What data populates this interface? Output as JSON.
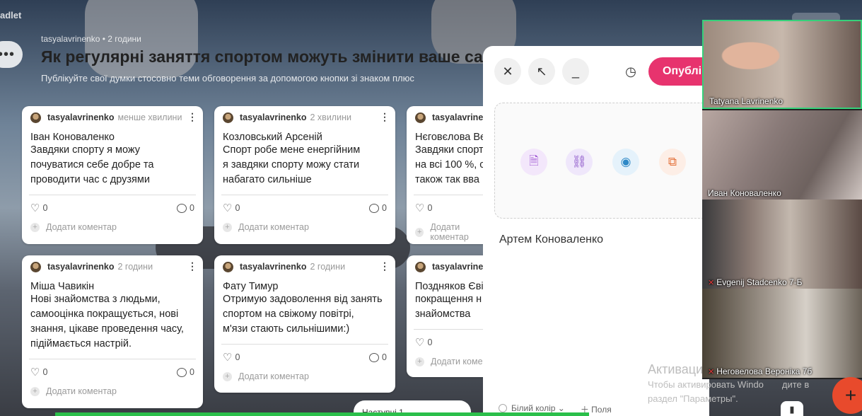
{
  "app": {
    "brand": "adlet"
  },
  "header": {
    "author": "tasyalavrinenko",
    "time": "2 години",
    "title": "Як регулярні заняття спортом можуть змінити ваше са",
    "subtitle": "Публікуйте свої думки стосовно теми обговорення за допомогою кнопки зі знаком плюс"
  },
  "cards": [
    {
      "author": "tasyalavrinenko",
      "time": "менше хвилини",
      "title": "Іван Коноваленко",
      "lines": [
        "Завдяки спорту я можу",
        "почуватися себе добре та",
        "проводити час с друзями"
      ],
      "likes": "0",
      "comments": "0",
      "add_comment": "Додати коментар"
    },
    {
      "author": "tasyalavrinenko",
      "time": "2 хвилини",
      "title": "Козловський Арсеній",
      "lines": [
        "Спорт робе мене енергійним",
        "я завдяки спорту можу стати",
        "набагато сильніше"
      ],
      "likes": "0",
      "comments": "0",
      "add_comment": "Додати коментар"
    },
    {
      "author": "tasyalavrinenko",
      "time": "",
      "title": "Нєговєлова Ве",
      "lines": [
        "Завдяки спорт",
        "на всі 100 %, с",
        "також так вва"
      ],
      "likes": "0",
      "comments": "",
      "add_comment": "Додати коментар"
    },
    {
      "author": "tasyalavrinenko",
      "time": "2 години",
      "title": "Міша Чавикін",
      "lines": [
        "Нові знайомства з людьми,",
        "самооцінка покращується, нові",
        "знання, цікаве проведення часу,",
        "підіймається настрій."
      ],
      "likes": "0",
      "comments": "0",
      "add_comment": "Додати коментар"
    },
    {
      "author": "tasyalavrinenko",
      "time": "2 години",
      "title": "Фату Тимур",
      "lines": [
        "Отримую задоволення від занять",
        "спортом на свіжому повітрі,",
        "м'язи стають сильнішими:)"
      ],
      "likes": "0",
      "comments": "0",
      "add_comment": "Додати коментар"
    },
    {
      "author": "tasyalavrinenko",
      "time": "",
      "title": "Поздняков Єві",
      "lines": [
        "покращення н",
        "знайомства"
      ],
      "likes": "0",
      "comments": "",
      "add_comment": "Додати комен"
    }
  ],
  "editor": {
    "publish_label": "Опублі",
    "author_name": "Артем Коноваленко",
    "color_label": "Білий колір",
    "fields_label": "Поля"
  },
  "video": {
    "tiles": [
      {
        "name": "Tatyana Lavrinenko",
        "muted": false
      },
      {
        "name": "Иван Коноваленко",
        "muted": false
      },
      {
        "name": "Evgenij Stadcenko 7-Б",
        "muted": true
      },
      {
        "name": "Неговелова Вероніка 7б",
        "muted": true
      }
    ]
  },
  "activation": {
    "title": "Активация Wi",
    "line1": "Чтобы активировать Windo",
    "line1b": "дите в",
    "line2": "раздел \"Параметры\"."
  },
  "bottom": {
    "pill_text": "Наступні 1"
  }
}
